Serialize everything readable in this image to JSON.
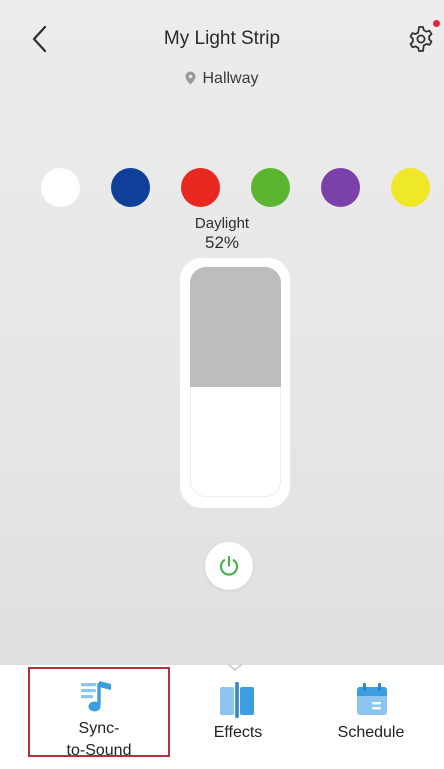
{
  "header": {
    "title": "My Light Strip",
    "location": "Hallway",
    "back_icon": "chevron-left-icon",
    "settings_icon": "gear-icon",
    "has_notification": true,
    "notification_color": "#e0263a"
  },
  "colors": {
    "swatches": [
      {
        "name": "white",
        "hex": "#ffffff"
      },
      {
        "name": "blue",
        "hex": "#0f3f99"
      },
      {
        "name": "red",
        "hex": "#e8271f"
      },
      {
        "name": "green",
        "hex": "#5cb531"
      },
      {
        "name": "purple",
        "hex": "#7a42a8"
      },
      {
        "name": "yellow",
        "hex": "#efe828"
      }
    ]
  },
  "brightness": {
    "preset_name": "Daylight",
    "value_label": "52%",
    "level": 0.52
  },
  "power": {
    "icon": "power-icon",
    "color": "#4caf50"
  },
  "bottom_nav": {
    "accent": "#3a9ee0",
    "selected_outline": "#b4303c",
    "tabs": [
      {
        "label": "Sync-\nto-Sound",
        "icon": "music-note-icon",
        "selected": true
      },
      {
        "label": "Effects",
        "icon": "effects-icon",
        "selected": false
      },
      {
        "label": "Schedule",
        "icon": "calendar-icon",
        "selected": false
      }
    ]
  }
}
